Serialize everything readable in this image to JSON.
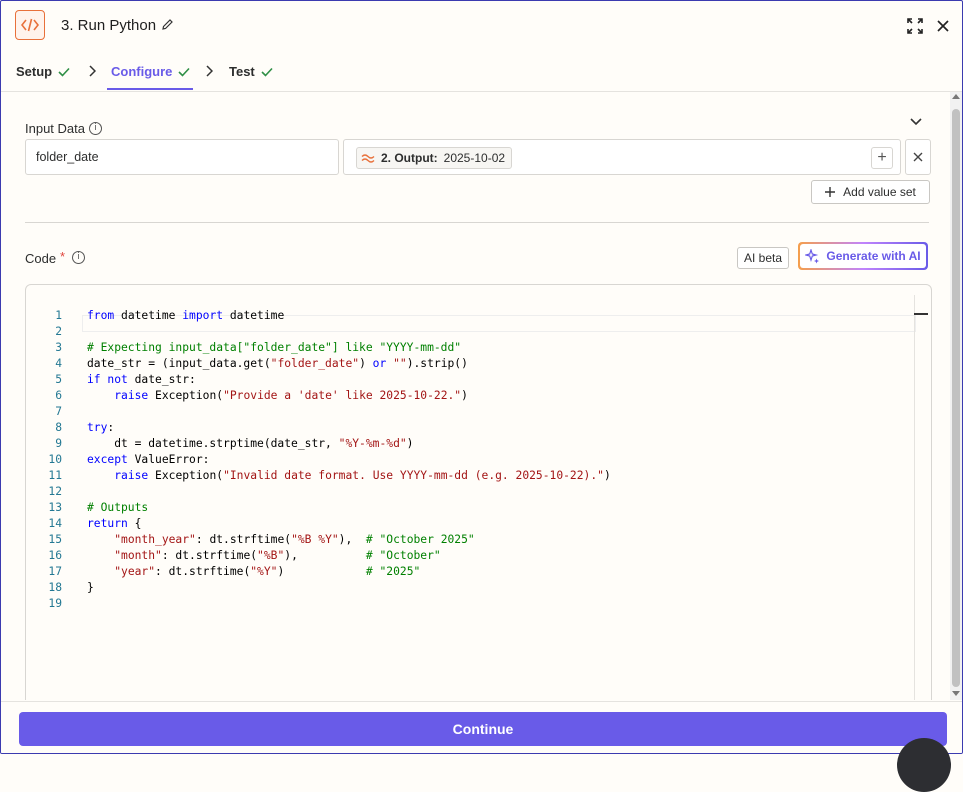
{
  "header": {
    "title": "3. Run Python",
    "icons": [
      "code-icon",
      "pencil-icon",
      "expand-icon",
      "close-icon"
    ]
  },
  "tabs": [
    {
      "label": "Setup",
      "complete": true
    },
    {
      "label": "Configure",
      "complete": true,
      "active": true
    },
    {
      "label": "Test",
      "complete": true
    }
  ],
  "input_data": {
    "label": "Input Data",
    "key_value": "folder_date",
    "chip_label": "2. Output:",
    "chip_value": "2025-10-02",
    "add_value_set": "Add value set"
  },
  "code": {
    "label": "Code",
    "required_mark": "*",
    "ai_beta": "AI beta",
    "generate_ai": "Generate with AI",
    "lines": [
      "from datetime import datetime",
      "",
      "# Expecting input_data[\"folder_date\"] like \"YYYY-mm-dd\"",
      "date_str = (input_data.get(\"folder_date\") or \"\").strip()",
      "if not date_str:",
      "    raise Exception(\"Provide a 'date' like 2025-10-22.\")",
      "",
      "try:",
      "    dt = datetime.strptime(date_str, \"%Y-%m-%d\")",
      "except ValueError:",
      "    raise Exception(\"Invalid date format. Use YYYY-mm-dd (e.g. 2025-10-22).\")",
      "",
      "# Outputs",
      "return {",
      "    \"month_year\": dt.strftime(\"%B %Y\"),  # \"October 2025\"",
      "    \"month\": dt.strftime(\"%B\"),          # \"October\"",
      "    \"year\": dt.strftime(\"%Y\")            # \"2025\"",
      "}",
      ""
    ]
  },
  "footer": {
    "continue_label": "Continue"
  },
  "colors": {
    "accent": "#695be8",
    "app_icon": "#e8703a",
    "check": "#2f8f46"
  }
}
